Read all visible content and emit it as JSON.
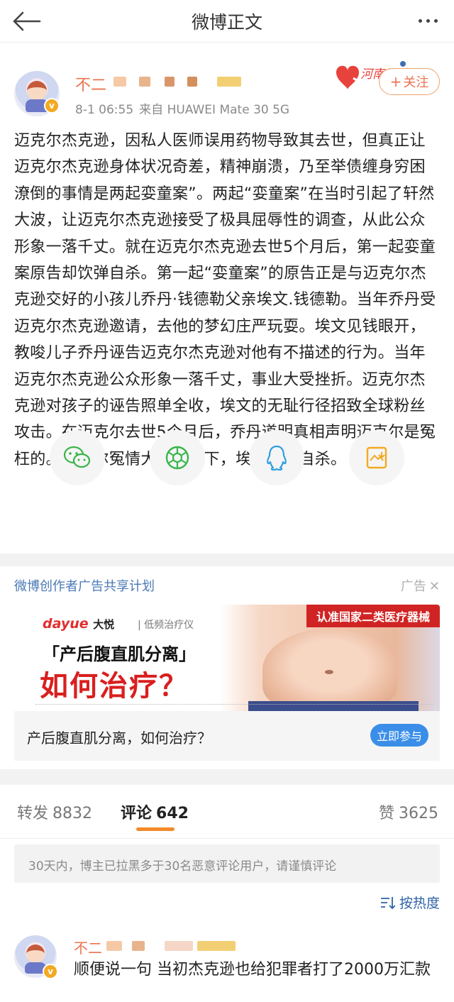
{
  "nav": {
    "title": "微博正文"
  },
  "post": {
    "username": "不二",
    "time": "8-1 06:55",
    "source": "来自 HUAWEI Mate 30 5G",
    "follow_label": "关注",
    "badge_text": "河南加油",
    "text": "迈克尔杰克逊，因私人医师误用药物导致其去世，但真正让迈克尔杰克逊身体状况奇差，精神崩溃，乃至举债缠身穷困潦倒的事情是两起娈童案”。两起“娈童案”在当时引起了轩然大波，让迈克尔杰克逊接受了极具屈辱性的调查，从此公众形象一落千丈。就在迈克尔杰克逊去世5个月后，第一起娈童案原告却饮弹自杀。第一起“娈童案”的原告正是与迈克尔杰克逊交好的小孩儿乔丹·钱德勒父亲埃文.钱德勒。当年乔丹受迈克尔杰克逊邀请，去他的梦幻庄严玩耍。埃文见钱眼开，教唆儿子乔丹诬告迈克尔杰克逊对他有不描述的行为。当年迈克尔杰克逊公众形象一落千丈，事业大受挫折。迈克尔杰克逊对孩子的诬告照单全收，埃文的无耻行径招致全球粉丝攻击。在迈克尔去世5个月后，乔丹道明真相声明迈克尔是冤枉的。迈克尔冤情大白于天下，埃文饮弹自杀。"
  },
  "share": {
    "items": [
      {
        "icon": "wechat-icon"
      },
      {
        "icon": "moments-icon"
      },
      {
        "icon": "qq-icon"
      },
      {
        "icon": "save-image-icon"
      }
    ]
  },
  "ad": {
    "plan_label": "微博创作者广告共享计划",
    "tag_label": "广告",
    "brand": "dayue",
    "brand_cn": "大悦",
    "brand_sub": "低频治疗仪",
    "banner": "认准国家二类医疗器械",
    "headline1": "「产后腹直肌分离」",
    "headline2": "如何治疗？",
    "bar_text": "产后腹直肌分离，如何治疗？",
    "cta": "立即参与"
  },
  "tabs": [
    {
      "label": "转发",
      "count": "8832"
    },
    {
      "label": "评论",
      "count": "642"
    },
    {
      "label": "赞",
      "count": "3625"
    }
  ],
  "notice": "30天内，博主已拉黑多于30名恶意评论用户，请谨慎评论",
  "sort_label": "按热度",
  "comment": {
    "username": "不二",
    "text": "顺便说一句  当初杰克逊也给犯罪者打了2000万汇款"
  },
  "colors": {
    "username": "#eb7350",
    "link": "#2f63a6",
    "accent": "#f48a2a",
    "cta": "#3b8ee8"
  }
}
